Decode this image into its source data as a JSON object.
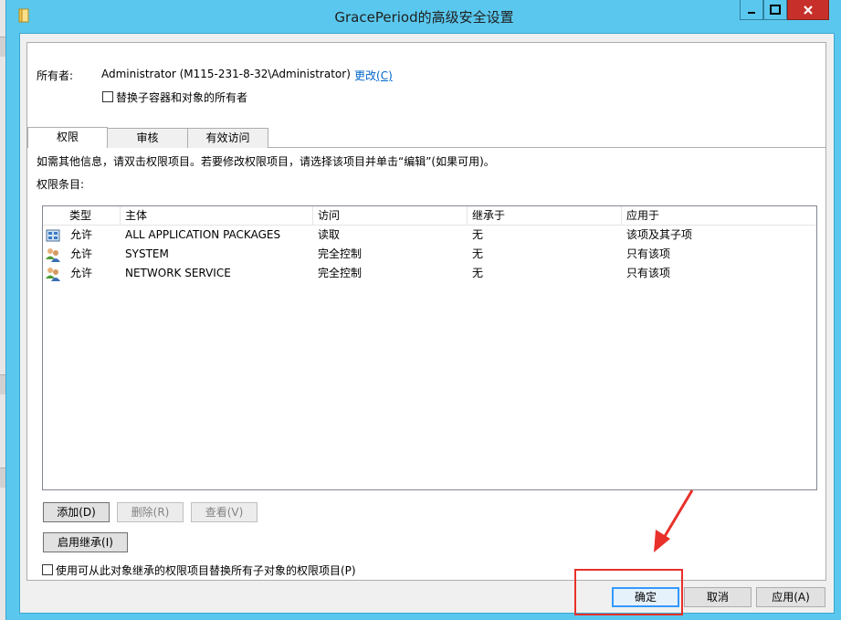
{
  "window": {
    "title": "GracePeriod的高级安全设置"
  },
  "owner": {
    "label": "所有者:",
    "value": "Administrator (M115-231-8-32\\Administrator)",
    "change_link": "更改",
    "change_hotkey": "(C)",
    "replace_checkbox_label": "替换子容器和对象的所有者",
    "replace_checked": false
  },
  "tabs": [
    {
      "label": "权限",
      "active": true
    },
    {
      "label": "审核",
      "active": false
    },
    {
      "label": "有效访问",
      "active": false
    }
  ],
  "info_text": "如需其他信息，请双击权限项目。若要修改权限项目，请选择该项目并单击“编辑”(如果可用)。",
  "entries_label": "权限条目:",
  "table": {
    "columns": [
      "类型",
      "主体",
      "访问",
      "继承于",
      "应用于"
    ],
    "rows": [
      {
        "icon": "package-icon",
        "type": "允许",
        "principal": "ALL APPLICATION PACKAGES",
        "access": "读取",
        "inherited": "无",
        "applies": "该项及其子项"
      },
      {
        "icon": "users-icon",
        "type": "允许",
        "principal": "SYSTEM",
        "access": "完全控制",
        "inherited": "无",
        "applies": "只有该项"
      },
      {
        "icon": "users-icon",
        "type": "允许",
        "principal": "NETWORK SERVICE",
        "access": "完全控制",
        "inherited": "无",
        "applies": "只有该项"
      }
    ]
  },
  "buttons": {
    "add": "添加(D)",
    "remove": "删除(R)",
    "view": "查看(V)",
    "enable_inheritance": "启用继承(I)",
    "ok": "确定",
    "cancel": "取消",
    "apply": "应用(A)"
  },
  "replace_child_permissions": {
    "label": "使用可从此对象继承的权限项目替换所有子对象的权限项目(P)",
    "checked": false
  },
  "annotation_color": "#e8312a"
}
